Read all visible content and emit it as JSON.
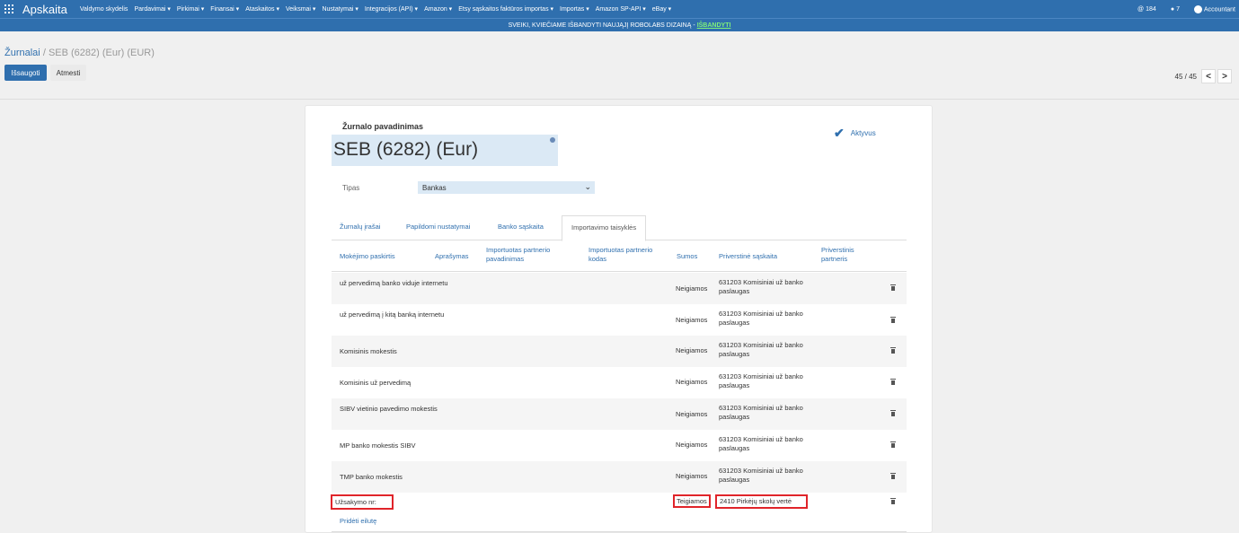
{
  "app": {
    "title": "Apskaita"
  },
  "nav": {
    "items": [
      "Valdymo skydelis",
      "Pardavimai ▾",
      "Pirkimai ▾",
      "Finansai ▾",
      "Ataskaitos ▾",
      "Veiksmai ▾",
      "Nustatymai ▾",
      "Integracijos (API) ▾",
      "Amazon ▾",
      "Etsy sąskaitos faktūros importas ▾",
      "Importas ▾",
      "Amazon SP-API ▾",
      "eBay ▾"
    ],
    "right": {
      "count": "184",
      "messages": "7",
      "user": "Accountant"
    }
  },
  "banner": {
    "text": "SVEIKI, KVIEČIAME IŠBANDYTI NAUJĄJĮ ROBOLABS DIZAINĄ -",
    "link": "IŠBANDYTI"
  },
  "breadcrumb": {
    "parent": "Žurnalai",
    "separator": "/",
    "current": "SEB (6282) (Eur) (EUR)"
  },
  "buttons": {
    "save": "Išsaugoti",
    "discard": "Atmesti"
  },
  "pager": {
    "text": "45 / 45",
    "prev": "<",
    "next": ">"
  },
  "form": {
    "name_label": "Žurnalo pavadinimas",
    "name_value": "SEB (6282) (Eur)",
    "active_label": "Aktyvus",
    "type_label": "Tipas",
    "type_value": "Bankas",
    "tabs": [
      "Žurnalų įrašai",
      "Papildomi nustatymai",
      "Banko sąskaita",
      "Importavimo taisyklės"
    ],
    "columns": {
      "purpose": "Mokėjimo paskirtis",
      "description": "Aprašymas",
      "partner_name": "Importuotas partnerio pavadinimas",
      "partner_code": "Importuotas partnerio kodas",
      "amounts": "Sumos",
      "forced_account": "Priverstinė sąskaita",
      "forced_partner": "Priverstinis partneris"
    },
    "rows": [
      {
        "purpose": "už pervedimą banko viduje internetu",
        "sign": "Neigiamos",
        "account": "631203 Komisiniai už banko paslaugas"
      },
      {
        "purpose": "už pervedimą į kitą banką internetu",
        "sign": "Neigiamos",
        "account": "631203 Komisiniai už banko paslaugas"
      },
      {
        "purpose": "Komisinis mokestis",
        "sign": "Neigiamos",
        "account": "631203 Komisiniai už banko paslaugas"
      },
      {
        "purpose": "Komisinis už pervedimą",
        "sign": "Neigiamos",
        "account": "631203 Komisiniai už banko paslaugas"
      },
      {
        "purpose": "SIBV vietinio pavedimo mokestis",
        "sign": "Neigiamos",
        "account": "631203 Komisiniai už banko paslaugas"
      },
      {
        "purpose": "MP banko mokestis SIBV",
        "sign": "Neigiamos",
        "account": "631203 Komisiniai už banko paslaugas"
      },
      {
        "purpose": "TMP banko mokestis",
        "sign": "Neigiamos",
        "account": "631203 Komisiniai už banko paslaugas"
      },
      {
        "purpose": "Užsakymo nr:",
        "sign": "Teigiamos",
        "account": "2410 Pirkėjų skolų vertė"
      }
    ],
    "add_line": "Pridėti eilutę"
  },
  "colors": {
    "primary": "#2f6fae",
    "highlight": "#e0242a",
    "banner_link": "#7ff07a"
  }
}
